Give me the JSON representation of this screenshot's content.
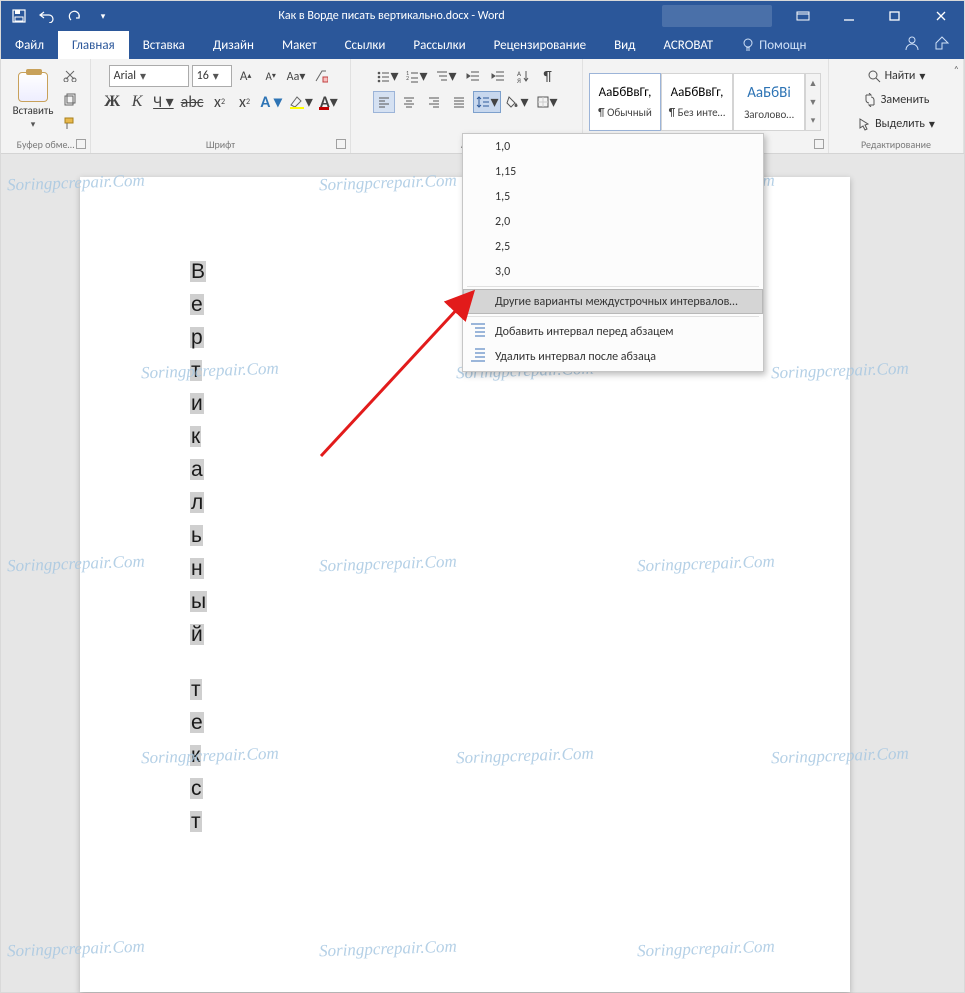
{
  "titlebar": {
    "doc_title": "Как в Ворде писать вертикально.docx - Word"
  },
  "tabs": {
    "file": "Файл",
    "home": "Главная",
    "insert": "Вставка",
    "design": "Дизайн",
    "layout": "Макет",
    "references": "Ссылки",
    "mailings": "Рассылки",
    "review": "Рецензирование",
    "view": "Вид",
    "acrobat": "ACROBAT",
    "tell_me": "Помощн"
  },
  "ribbon": {
    "clipboard": {
      "paste": "Вставить",
      "group": "Буфер обме…"
    },
    "font": {
      "name": "Arial",
      "size": "16",
      "group": "Шрифт"
    },
    "paragraph": {
      "group": "Аб"
    },
    "styles": {
      "preview": "АаБбВвГг,",
      "normal": "¶ Обычный",
      "nospacing": "¶ Без инте…",
      "heading_preview": "АаБбВі",
      "heading1": "Заголово…"
    },
    "editing": {
      "find": "Найти",
      "replace": "Заменить",
      "select": "Выделить",
      "group": "Редактирование"
    }
  },
  "line_spacing_menu": {
    "v1": "1,0",
    "v2": "1,15",
    "v3": "1,5",
    "v4": "2,0",
    "v5": "2,5",
    "v6": "3,0",
    "more": "Другие варианты междустрочных интервалов…",
    "add_before": "Добавить интервал перед абзацем",
    "remove_after": "Удалить интервал после абзаца"
  },
  "document": {
    "vertical_chars": [
      "В",
      "е",
      "р",
      "т",
      "и",
      "к",
      "а",
      "л",
      "ь",
      "н",
      "ы",
      "й",
      "",
      "т",
      "е",
      "к",
      "с",
      "т"
    ]
  },
  "watermark": "Soringpcrepair.Com"
}
